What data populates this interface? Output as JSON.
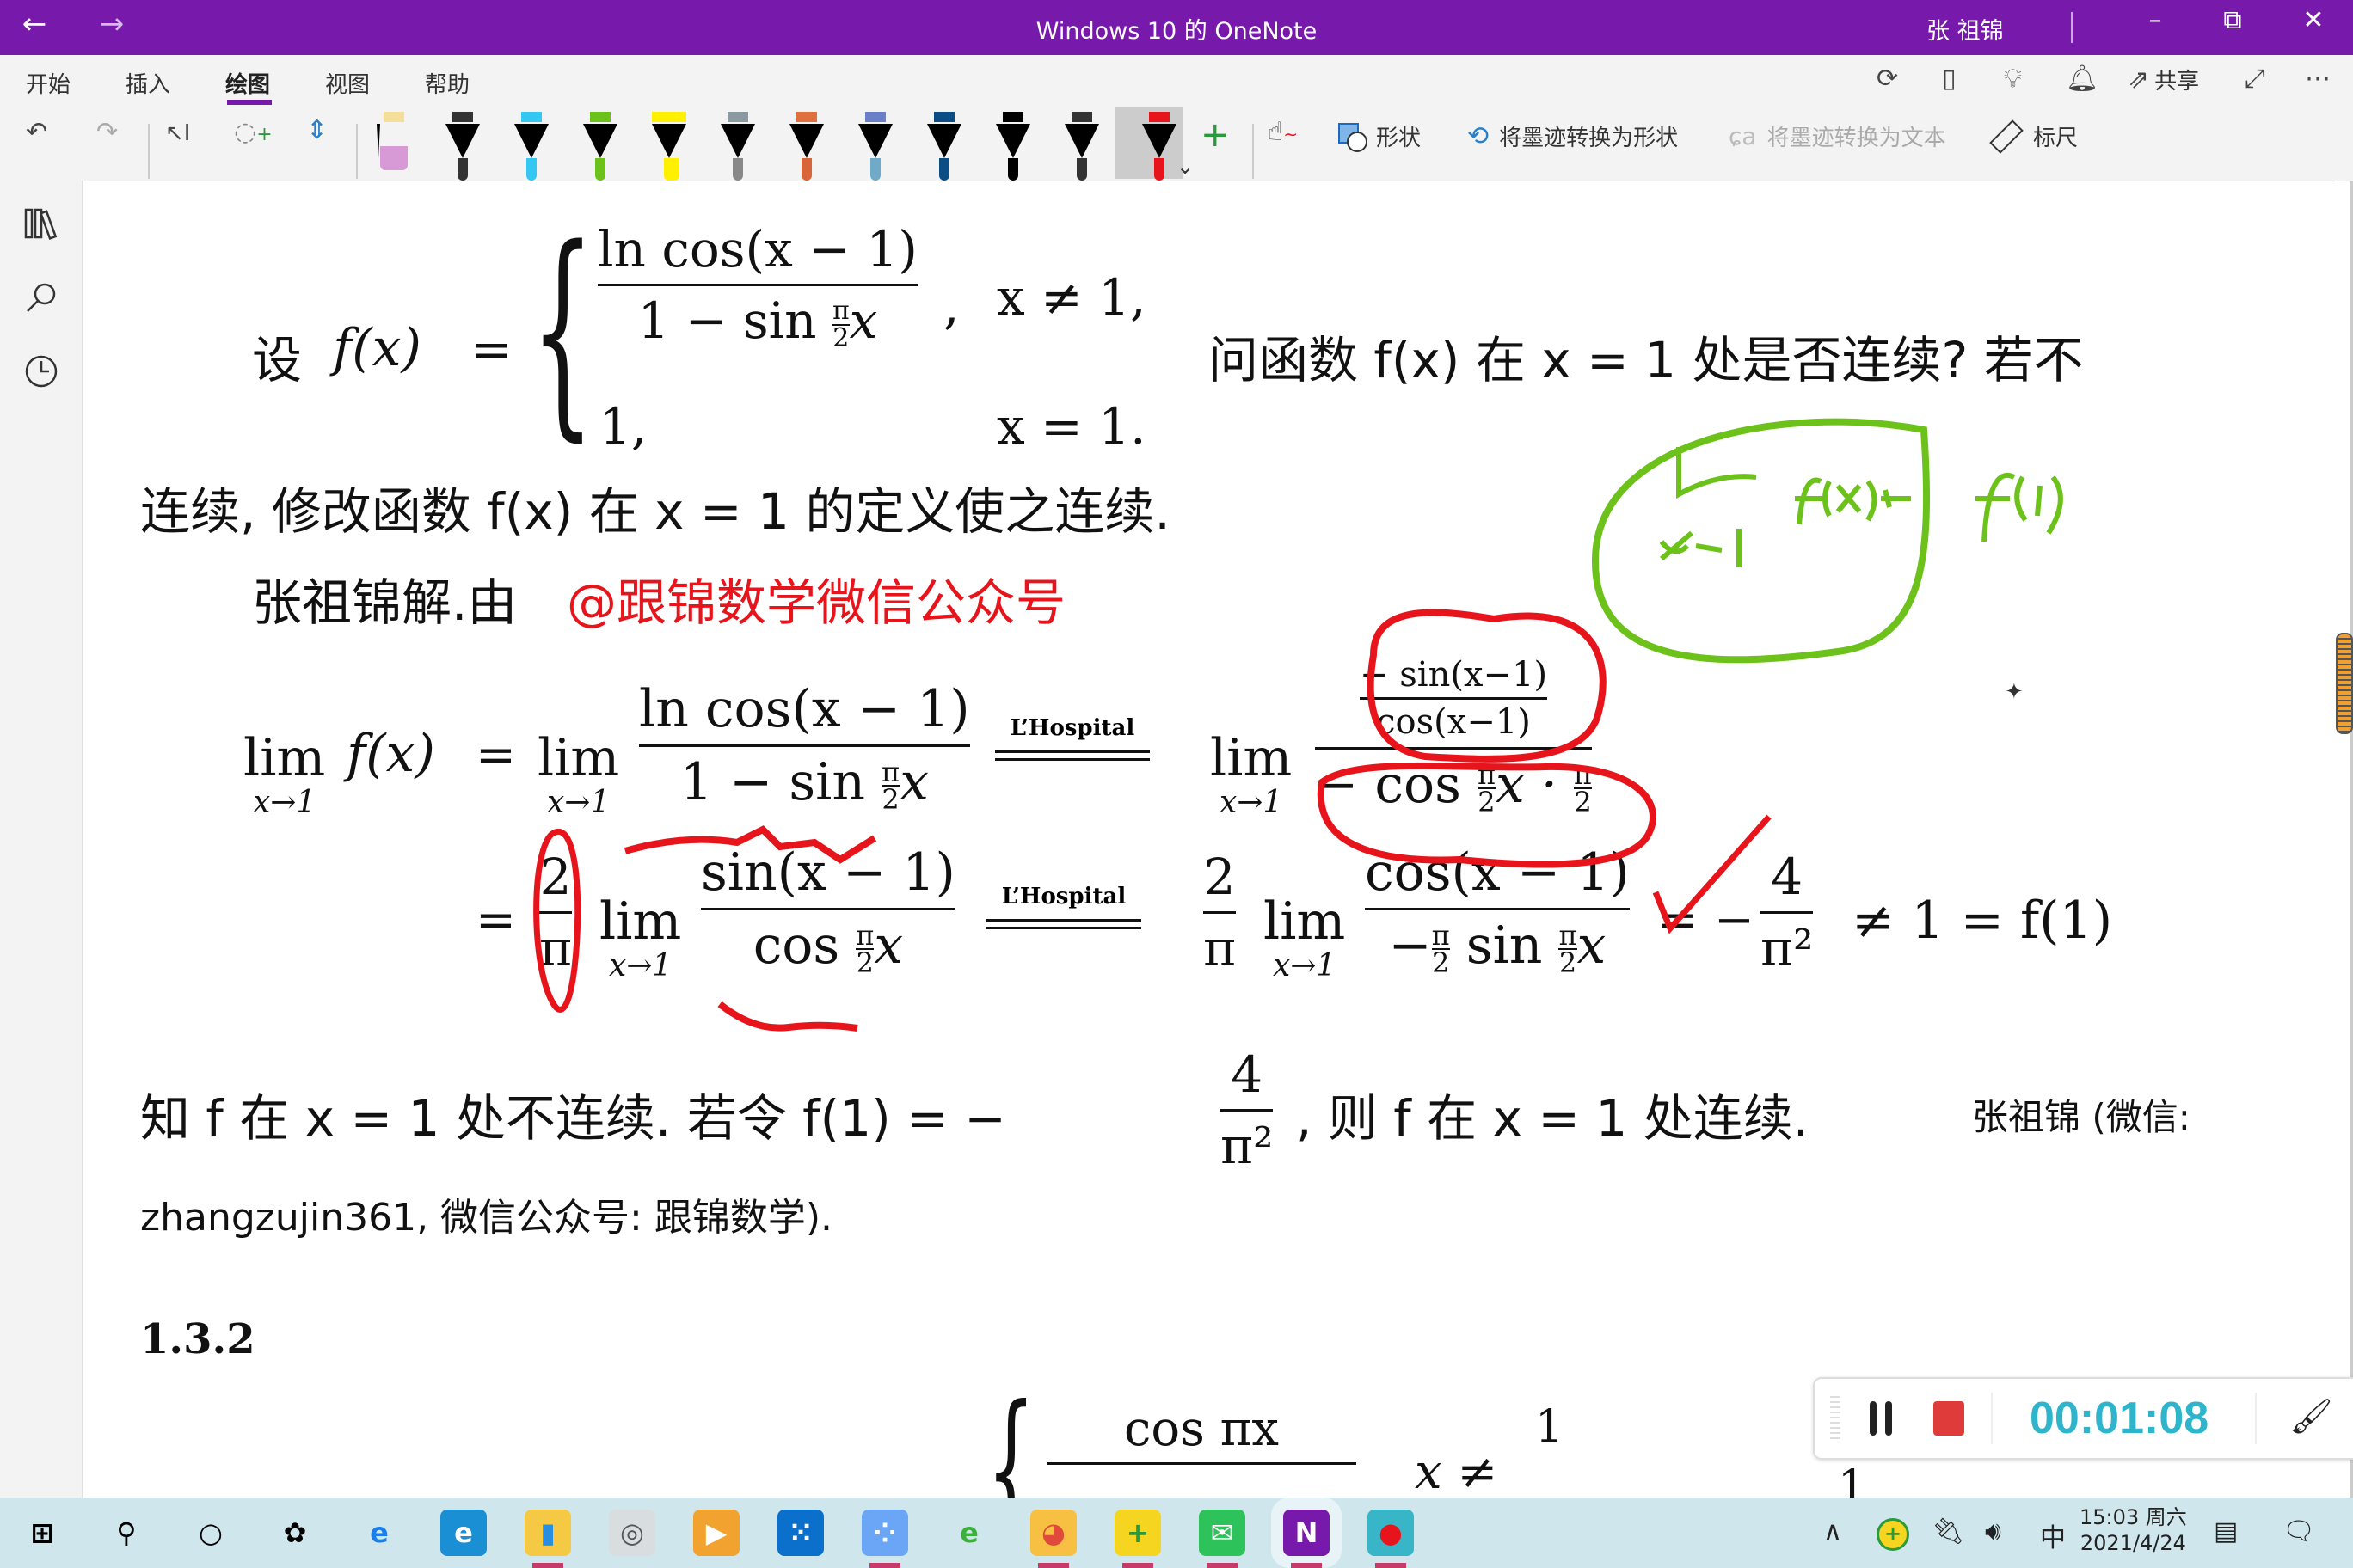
{
  "window": {
    "title": "Windows 10 的 OneNote",
    "user": "张 祖锦",
    "back_icon": "←",
    "forward_icon": "→",
    "minimize": "–",
    "restore": "⧉",
    "close": "✕"
  },
  "menu": {
    "tabs": [
      {
        "label": "开始",
        "active": false
      },
      {
        "label": "插入",
        "active": false
      },
      {
        "label": "绘图",
        "active": true
      },
      {
        "label": "视图",
        "active": false
      },
      {
        "label": "帮助",
        "active": false
      }
    ],
    "share_label": "共享",
    "right_icons": [
      "sync-icon",
      "page-icon",
      "lightbulb-icon",
      "bell-icon",
      "share-icon",
      "expand-icon",
      "more-icon"
    ]
  },
  "toolbar": {
    "undo": "↶",
    "redo": "↷",
    "pens": [
      {
        "cap": "#f5dd9a",
        "tip": "#d79ad6",
        "kind": "eraser"
      },
      {
        "cap": "#333333",
        "tip": "#333333"
      },
      {
        "cap": "#33c7f2",
        "tip": "#33c7f2"
      },
      {
        "cap": "#6cc21a",
        "tip": "#6cc21a"
      },
      {
        "cap": "#ffef00",
        "tip": "#ffef00",
        "kind": "highlighter"
      },
      {
        "cap": "#8a9aa0",
        "tip": "#888888"
      },
      {
        "cap": "#e07040",
        "tip": "#d8643a"
      },
      {
        "cap": "#6a80c8",
        "tip": "#70aac8"
      },
      {
        "cap": "#0d4d86",
        "tip": "#0d4d86"
      },
      {
        "cap": "#000000",
        "tip": "#000000"
      },
      {
        "cap": "#333333",
        "tip": "#333333"
      },
      {
        "cap": "#e8141b",
        "tip": "#e8141b",
        "selected": true
      }
    ],
    "add_pen": "+",
    "shapes_label": "形状",
    "ink_to_shape_label": "将墨迹转换为形状",
    "ink_to_text_label": "将墨迹转换为文本",
    "ruler_label": "标尺"
  },
  "sidebar": {
    "icons": [
      "notebooks-icon",
      "search-icon",
      "recent-icon"
    ]
  },
  "content": {
    "problem": {
      "intro": "设",
      "fx": "f(x)",
      "eq": "=",
      "case1_num": "ln cos(x − 1)",
      "case1_den": "1 − sin ",
      "case1_den_pi": "π",
      "case1_den_two": "2",
      "case1_den_x": "x",
      "case1_comma": ",",
      "case1_cond": "x ≠ 1,",
      "case2_val": "1,",
      "case2_cond": "x = 1.",
      "question_tail": "问函数 f(x) 在 x = 1 处是否连续? 若不",
      "line2": "连续, 修改函数 f(x) 在 x = 1 的定义使之连续."
    },
    "solution": {
      "author": "张祖锦解.由",
      "watermark": "@跟锦数学微信公众号",
      "lim_word": "lim",
      "lim_sub": "x→1",
      "fx": "f(x)",
      "eq": "=",
      "num1": "ln cos(x − 1)",
      "den1": "1 − sin",
      "den1_x": "x",
      "hospital": "L’Hospital",
      "inner_num": "− sin(x−1)",
      "inner_den": "cos(x−1)",
      "den2": "− cos",
      "den2_x": "x ·",
      "pi": "π",
      "two": "2",
      "row2_num1": "sin(x − 1)",
      "row2_den1": "cos",
      "row2_num2": "cos(x − 1)",
      "row2_den2_a": "−",
      "row2_den2_b": "sin",
      "minus": "−",
      "four": "4",
      "pi_sq": "π²",
      "tail": "≠ 1 = f(1)"
    },
    "conclusion": {
      "line1_a": "知 f 在 x = 1 处不连续. 若令 f(1) = −",
      "line1_b": ", 则 f 在 x = 1 处连续.",
      "line1_c": "张祖锦 (微信:",
      "line2": "zhangzujin361, 微信公众号: 跟锦数学)."
    },
    "next": {
      "section": "1.3.2",
      "num": "cos πx",
      "cond": "x ≠",
      "cond_num": "1",
      "cond_comma": ","
    },
    "ink": {
      "green_text": "lim f(x) ≠ f(1)",
      "green_sub": "x→1",
      "colors": {
        "green": "#6cc21a",
        "red": "#e8141b"
      }
    }
  },
  "recorder": {
    "timer": "00:01:08",
    "pause_icon": "pause-icon",
    "stop_icon": "stop-icon",
    "brush_icon": "brush-icon"
  },
  "taskbar": {
    "apps": [
      {
        "name": "start",
        "glyph": "⊞",
        "bg": "transparent",
        "fg": "#000"
      },
      {
        "name": "search",
        "glyph": "⚲",
        "bg": "transparent",
        "fg": "#000"
      },
      {
        "name": "cortana",
        "glyph": "○",
        "bg": "transparent",
        "fg": "#000"
      },
      {
        "name": "app-1",
        "glyph": "✿",
        "bg": "transparent",
        "fg": "#000"
      },
      {
        "name": "ie",
        "glyph": "e",
        "bg": "transparent",
        "fg": "#1a7ee8"
      },
      {
        "name": "edge",
        "glyph": "e",
        "bg": "#1b8fd3",
        "fg": "#fff"
      },
      {
        "name": "file-explorer",
        "glyph": "▮",
        "bg": "#f6c944",
        "fg": "#2a8ee0",
        "running": true
      },
      {
        "name": "app-vm",
        "glyph": "◎",
        "bg": "#d8dde0",
        "fg": "#555"
      },
      {
        "name": "media-player",
        "glyph": "▶",
        "bg": "#f2a22e",
        "fg": "#fff"
      },
      {
        "name": "app-blue",
        "glyph": "⁙",
        "bg": "#0a70cc",
        "fg": "#fff"
      },
      {
        "name": "app-video",
        "glyph": "⁘",
        "bg": "#6aa6f5",
        "fg": "#fff",
        "running": true
      },
      {
        "name": "ie-green",
        "glyph": "e",
        "bg": "transparent",
        "fg": "#3bb03b"
      },
      {
        "name": "chrome-like",
        "glyph": "◕",
        "bg": "#f7c042",
        "fg": "#e04a3a",
        "running": true
      },
      {
        "name": "360-security",
        "glyph": "+",
        "bg": "#f5d520",
        "fg": "#2a9a3a",
        "running": true
      },
      {
        "name": "wechat",
        "glyph": "✉",
        "bg": "#2ec25a",
        "fg": "#fff",
        "running": true
      },
      {
        "name": "onenote",
        "glyph": "N",
        "bg": "#7719AA",
        "fg": "#fff",
        "running": true,
        "active": true
      },
      {
        "name": "screen-recorder",
        "glyph": "●",
        "bg": "#38b6c8",
        "fg": "#e8141b",
        "running": true
      }
    ],
    "tray": {
      "chevron": "∧",
      "ime": "中",
      "time": "15:03 周六",
      "date": "2021/4/24"
    }
  }
}
